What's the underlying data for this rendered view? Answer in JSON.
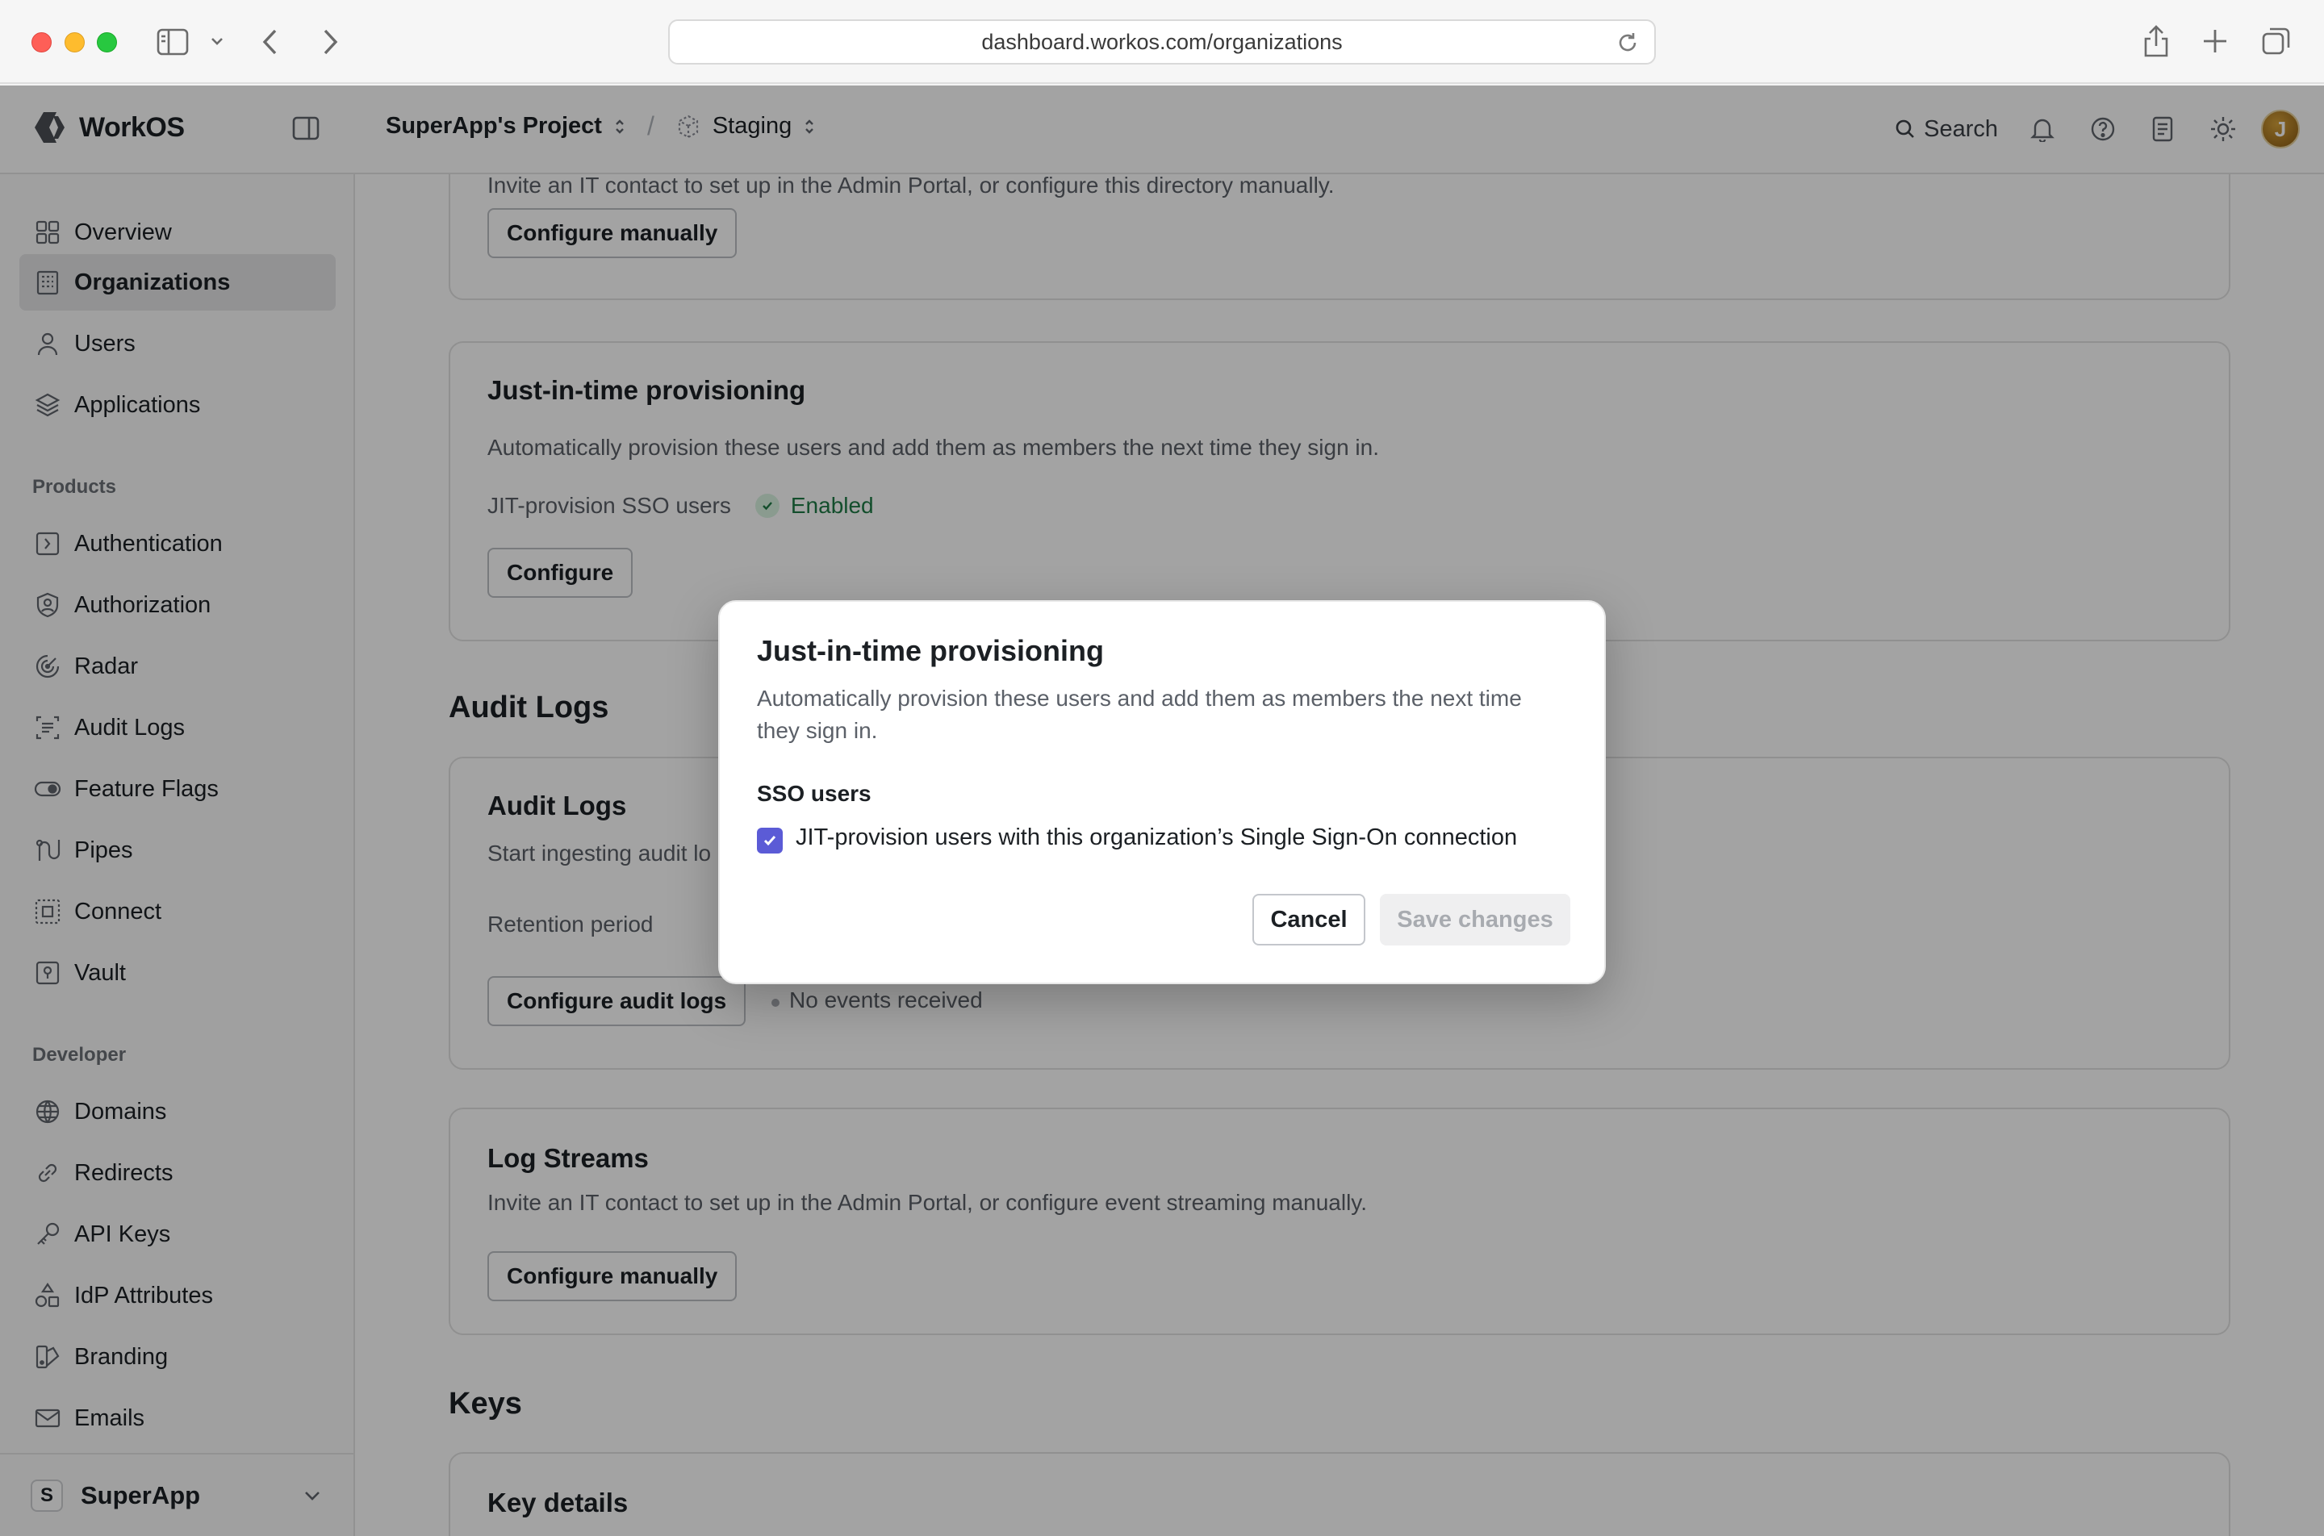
{
  "browser": {
    "url": "dashboard.workos.com/organizations"
  },
  "topbar": {
    "brand": "WorkOS",
    "project": "SuperApp's Project",
    "separator": "/",
    "environment": "Staging",
    "search_label": "Search",
    "avatar_initial": "J"
  },
  "sidebar": {
    "primary": [
      {
        "label": "Overview",
        "icon": "grid-icon"
      },
      {
        "label": "Organizations",
        "icon": "building-icon",
        "active": true
      },
      {
        "label": "Users",
        "icon": "user-icon"
      },
      {
        "label": "Applications",
        "icon": "layers-icon"
      }
    ],
    "products_label": "Products",
    "products": [
      {
        "label": "Authentication",
        "icon": "key-box-icon"
      },
      {
        "label": "Authorization",
        "icon": "shield-user-icon"
      },
      {
        "label": "Radar",
        "icon": "radar-icon"
      },
      {
        "label": "Audit Logs",
        "icon": "audit-logs-icon"
      },
      {
        "label": "Feature Flags",
        "icon": "toggle-icon"
      },
      {
        "label": "Pipes",
        "icon": "pipes-icon"
      },
      {
        "label": "Connect",
        "icon": "connect-icon"
      },
      {
        "label": "Vault",
        "icon": "vault-icon"
      }
    ],
    "developer_label": "Developer",
    "developer": [
      {
        "label": "Domains",
        "icon": "globe-icon"
      },
      {
        "label": "Redirects",
        "icon": "link-icon"
      },
      {
        "label": "API Keys",
        "icon": "api-key-icon"
      },
      {
        "label": "IdP Attributes",
        "icon": "shapes-icon"
      },
      {
        "label": "Branding",
        "icon": "branding-icon"
      },
      {
        "label": "Emails",
        "icon": "mail-icon"
      }
    ],
    "workspace": {
      "initial": "S",
      "name": "SuperApp"
    }
  },
  "main": {
    "directory_card": {
      "partial_text": "Invite an IT contact to set up in the Admin Portal, or configure this directory manually.",
      "button": "Configure manually"
    },
    "jit_card": {
      "title": "Just-in-time provisioning",
      "description": "Automatically provision these users and add them as members the next time they sign in.",
      "row_label": "JIT-provision SSO users",
      "status": "Enabled",
      "button": "Configure"
    },
    "audit_logs_heading": "Audit Logs",
    "audit_card": {
      "title": "Audit Logs",
      "description_partial": "Start ingesting audit lo",
      "retention_label": "Retention period",
      "button": "Configure audit logs",
      "events_status": "No events received"
    },
    "log_streams_card": {
      "title": "Log Streams",
      "description": "Invite an IT contact to set up in the Admin Portal, or configure event streaming manually.",
      "button": "Configure manually"
    },
    "keys_heading": "Keys",
    "key_card": {
      "title": "Key details"
    }
  },
  "modal": {
    "title": "Just-in-time provisioning",
    "description": "Automatically provision these users and add them as members the next time they sign in.",
    "section_label": "SSO users",
    "checkbox_label": "JIT-provision users with this organization’s Single Sign-On connection",
    "checkbox_checked": true,
    "cancel_label": "Cancel",
    "save_label": "Save changes"
  },
  "colors": {
    "accent": "#5b5bd6",
    "enabled_green": "#1f7a45",
    "active_nav_bg": "#e4e4e7"
  }
}
